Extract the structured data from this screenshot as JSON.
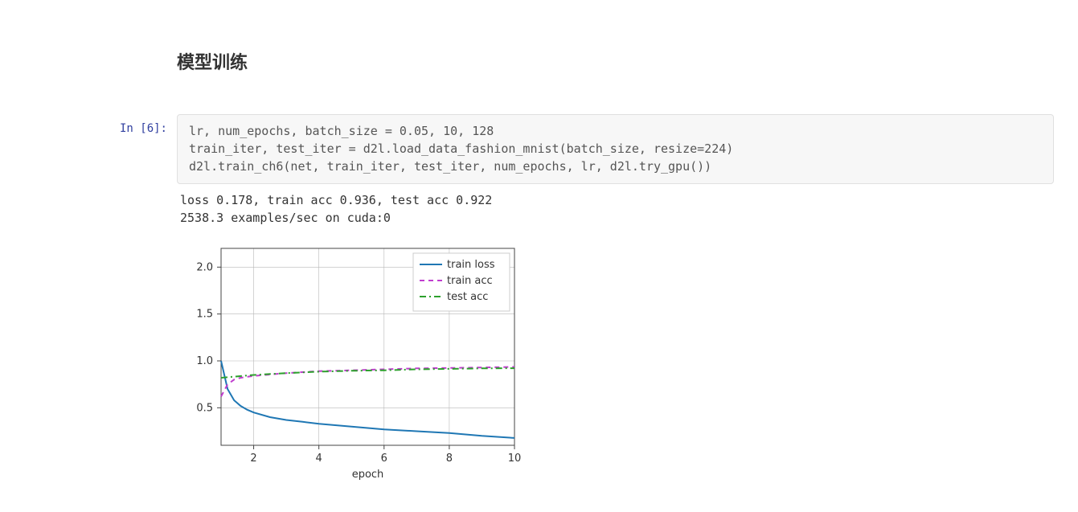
{
  "markdown": {
    "heading": "模型训练"
  },
  "cell": {
    "prompt": "In [6]:",
    "code_line1": "lr, num_epochs, batch_size = 0.05, 10, 128",
    "code_line2": "train_iter, test_iter = d2l.load_data_fashion_mnist(batch_size, resize=224)",
    "code_line3": "d2l.train_ch6(net, train_iter, test_iter, num_epochs, lr, d2l.try_gpu())",
    "output_line1": "loss 0.178, train acc 0.936, test acc 0.922",
    "output_line2": "2538.3 examples/sec on cuda:0"
  },
  "chart_data": {
    "type": "line",
    "title": "",
    "xlabel": "epoch",
    "ylabel": "",
    "xlim": [
      1,
      10
    ],
    "ylim": [
      0.1,
      2.2
    ],
    "x_ticks": [
      2,
      4,
      6,
      8,
      10
    ],
    "y_ticks": [
      0.5,
      1.0,
      1.5,
      2.0
    ],
    "legend_position": "upper-right",
    "series": [
      {
        "name": "train loss",
        "color": "#1f77b4",
        "style": "solid",
        "x": [
          1.0,
          1.2,
          1.4,
          1.6,
          1.8,
          2.0,
          2.5,
          3.0,
          3.5,
          4.0,
          5.0,
          6.0,
          7.0,
          8.0,
          9.0,
          10.0
        ],
        "y": [
          1.0,
          0.7,
          0.58,
          0.52,
          0.48,
          0.45,
          0.4,
          0.37,
          0.35,
          0.33,
          0.3,
          0.27,
          0.25,
          0.23,
          0.2,
          0.178
        ]
      },
      {
        "name": "train acc",
        "color": "#c03dcf",
        "style": "dashed",
        "x": [
          1.0,
          1.2,
          1.4,
          1.6,
          1.8,
          2.0,
          3.0,
          4.0,
          5.0,
          6.0,
          7.0,
          8.0,
          9.0,
          10.0
        ],
        "y": [
          0.62,
          0.75,
          0.8,
          0.82,
          0.83,
          0.84,
          0.87,
          0.89,
          0.9,
          0.91,
          0.92,
          0.925,
          0.93,
          0.936
        ]
      },
      {
        "name": "test acc",
        "color": "#2ca02c",
        "style": "dashdot",
        "x": [
          1.0,
          2.0,
          3.0,
          4.0,
          5.0,
          6.0,
          7.0,
          8.0,
          9.0,
          10.0
        ],
        "y": [
          0.82,
          0.85,
          0.87,
          0.885,
          0.895,
          0.9,
          0.91,
          0.915,
          0.92,
          0.922
        ]
      }
    ]
  },
  "chart_legend": {
    "s0": "train loss",
    "s1": "train acc",
    "s2": "test acc"
  },
  "chart_ticks": {
    "x2": "2",
    "x4": "4",
    "x6": "6",
    "x8": "8",
    "x10": "10",
    "y05": "0.5",
    "y10": "1.0",
    "y15": "1.5",
    "y20": "2.0",
    "xlabel": "epoch"
  }
}
